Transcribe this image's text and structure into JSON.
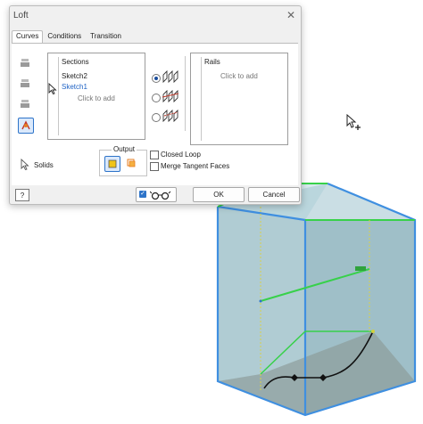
{
  "dialog": {
    "title": "Loft",
    "tabs": [
      {
        "label": "Curves",
        "active": true
      },
      {
        "label": "Conditions",
        "active": false
      },
      {
        "label": "Transition",
        "active": false
      }
    ],
    "sections": {
      "header": "Sections",
      "items": [
        {
          "label": "Sketch2",
          "selected": false
        },
        {
          "label": "Sketch1",
          "selected": true
        }
      ],
      "click_to_add": "Click to add"
    },
    "rails": {
      "header": "Rails",
      "click_to_add": "Click to add"
    },
    "solids_label": "Solids",
    "output_label": "Output",
    "closed_loop_label": "Closed Loop",
    "merge_tangent_label": "Merge Tangent Faces",
    "ok_label": "OK",
    "cancel_label": "Cancel",
    "help_icon": "question-icon",
    "preview_icon": "glasses-icon",
    "colors": {
      "accent": "#2e74c9",
      "selected_text": "#1f63c5"
    }
  },
  "model": {
    "box_edge_color": "#3f8fe0",
    "highlight_edge_color": "#37d14a",
    "face_color": "#8fb6c0",
    "floor_color": "#8c9a96"
  }
}
